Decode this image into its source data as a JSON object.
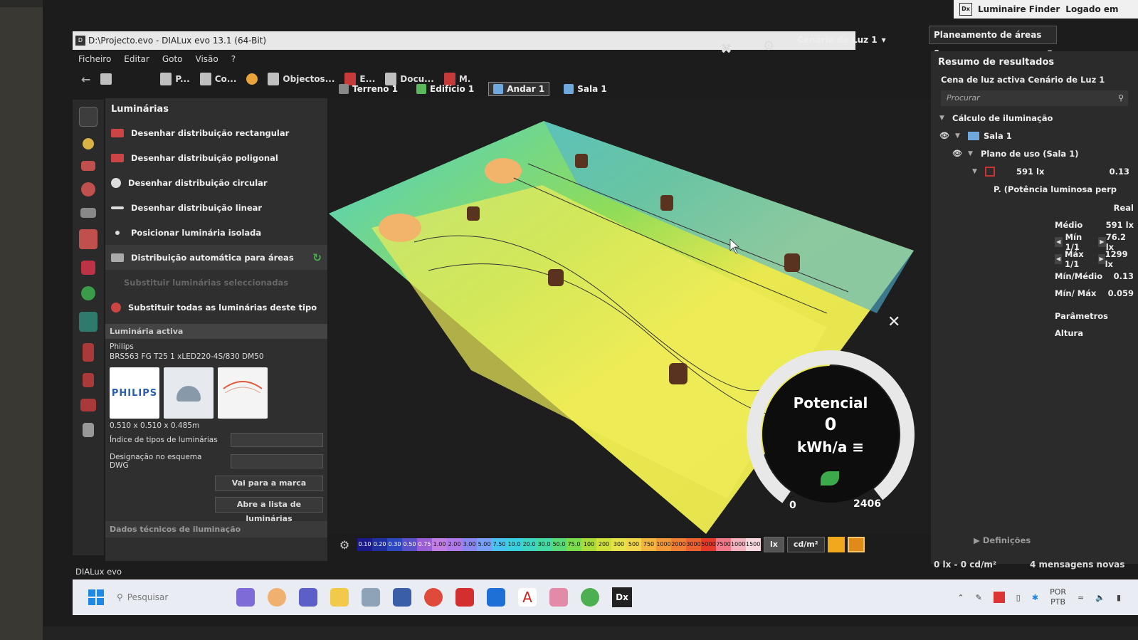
{
  "window": {
    "title": "D:\\Projecto.evo - DIALux evo 13.1 (64-Bit)",
    "top_right": {
      "finder": "Luminaire Finder",
      "login": "Logado em"
    }
  },
  "menu": [
    "Ficheiro",
    "Editar",
    "Goto",
    "Visão",
    "?"
  ],
  "toolbar": {
    "items": [
      "P...",
      "Co...",
      "Objectos...",
      "E...",
      "Docu...",
      "M."
    ],
    "scene": "Cenário de Luz 1",
    "plan": "Planeamento de áreas e..."
  },
  "breadcrumb": [
    "Terreno 1",
    "Edifício 1",
    "Andar 1",
    "Sala 1"
  ],
  "left_panel": {
    "title": "Luminárias",
    "items": [
      "Desenhar distribuição rectangular",
      "Desenhar distribuição poligonal",
      "Desenhar distribuição circular",
      "Desenhar distribuição linear",
      "Posicionar luminária isolada",
      "Distribuição automática para áreas",
      "Substituir luminárias seleccionadas",
      "Substituir todas as luminárias deste tipo"
    ],
    "active_header": "Luminária activa",
    "brand": "Philips",
    "model": "BRS563 FG T25 1 xLED220-4S/830 DM50",
    "logo_text": "PHILIPS",
    "dimensions": "0.510 x 0.510 x 0.485m",
    "field1": "Índice de tipos de luminárias",
    "field2": "Designação no esquema DWG",
    "btn_brand": "Vai para a marca",
    "btn_list": "Abre a lista de luminárias",
    "tech_header": "Dados técnicos de iluminação"
  },
  "gauge": {
    "title": "Potencial",
    "value": "0",
    "unit": "kWh/a",
    "min": "0",
    "max": "2406"
  },
  "scale": {
    "values": [
      "0.10",
      "0.20",
      "0.30",
      "0.50",
      "0.75",
      "1.00",
      "2.00",
      "3.00",
      "5.00",
      "7.50",
      "10.0",
      "20.0",
      "30.0",
      "50.0",
      "75.0",
      "100",
      "200",
      "300",
      "500",
      "750",
      "1000",
      "2000",
      "3000",
      "5000",
      "7500",
      "10000",
      "15000"
    ],
    "colors": [
      "#1a1a8a",
      "#1f2fa0",
      "#2b48c0",
      "#5a50c8",
      "#9a5fd6",
      "#c27fe3",
      "#b07ae9",
      "#8a88f0",
      "#7aa0f5",
      "#4bc3f0",
      "#3ad0e0",
      "#3ed6c2",
      "#45d9a4",
      "#58da78",
      "#7ddc4e",
      "#a9dc38",
      "#cfe03a",
      "#e6e24a",
      "#f1d64b",
      "#f2b540",
      "#f29a3a",
      "#ee7f35",
      "#ec6230",
      "#e63b2b",
      "#f07a8a",
      "#f3b4c0",
      "#f7d9df"
    ],
    "unit_lx": "lx",
    "unit_cd": "cd/m²"
  },
  "right_panel": {
    "title": "Resumo de resultados",
    "active_scene": "Cena de luz activa Cenário de Luz 1",
    "search_placeholder": "Procurar",
    "tree": {
      "calc": "Cálculo de iluminação",
      "room": "Sala 1",
      "plane": "Plano de uso (Sala 1)",
      "value_lx": "591 lx",
      "value_ratio": "0.13",
      "power": "P. (Potência luminosa perp"
    },
    "results": {
      "real": "Real",
      "medio_label": "Médio",
      "medio": "591 lx",
      "min_label": "Mín 1/1",
      "min": "76.2 lx",
      "max_label": "Máx 1/1",
      "max": "1299 lx",
      "minmed_label": "Mín/Médio",
      "minmed": "0.13",
      "minmax_label": "Mín/ Máx",
      "minmax": "0.059",
      "params": "Parâmetros",
      "altura": "Altura"
    },
    "footer": "Definições"
  },
  "status": {
    "app": "DIALux evo",
    "units": "0 lx - 0 cd/m²",
    "messages": "4 mensagens novas"
  },
  "taskbar": {
    "search": "Pesquisar",
    "lang": "POR",
    "lang2": "PTB",
    "dx": "Dx"
  }
}
